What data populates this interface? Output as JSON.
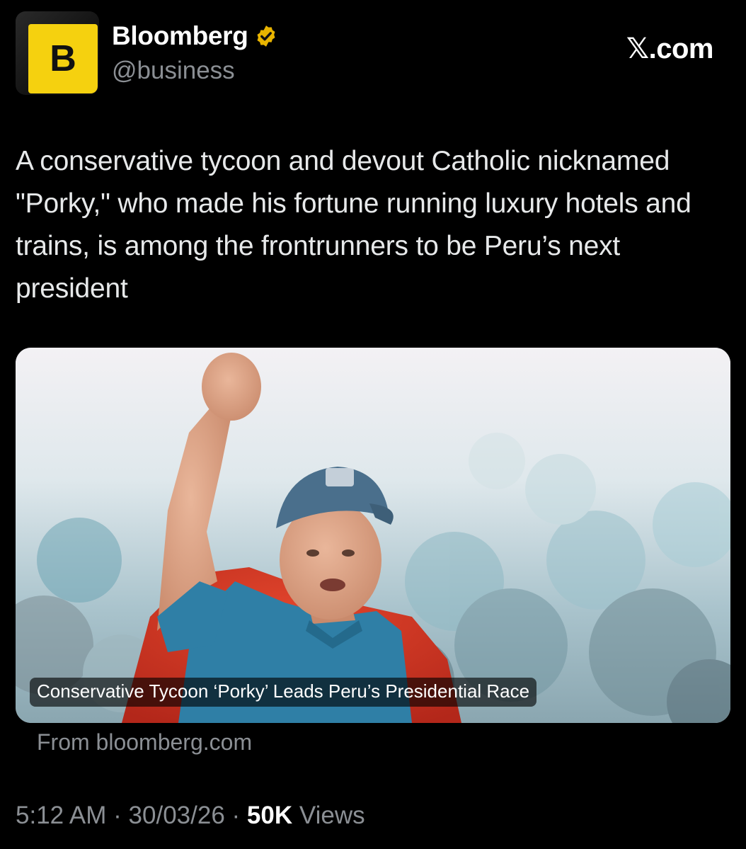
{
  "account": {
    "display_name": "Bloomberg",
    "handle": "@business",
    "avatar_letter": "B",
    "avatar_color": "#f5d10f",
    "verified_badge": "verified-badge-icon",
    "badge_color": "#e8b400"
  },
  "site_mark": "𝕏.com",
  "tweet": {
    "text": "A conservative tycoon and devout Catholic nicknamed \"Porky,\" who made his fortune running luxury hotels and trains, is among the frontrunners to be Peru’s next president"
  },
  "link_card": {
    "headline": "Conservative Tycoon ‘Porky’ Leads Peru’s Presidential Race",
    "source": "From bloomberg.com"
  },
  "meta": {
    "time": "5:12 AM",
    "separator": "·",
    "date": "30/03/26",
    "views_count": "50K",
    "views_label": "Views"
  }
}
